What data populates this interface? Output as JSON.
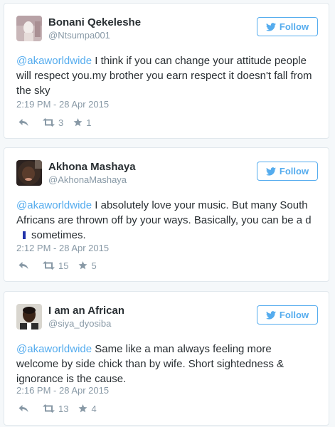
{
  "follow_label": "Follow",
  "colors": {
    "accent": "#55acee",
    "muted": "#8899a6",
    "text": "#292f33",
    "background": "#f5f8fa"
  },
  "tweets": [
    {
      "name": "Bonani Qekeleshe",
      "handle": "@Ntsumpa001",
      "mention": "@akaworldwide",
      "text": " I think if you can change your attitude people will respect you.my brother you earn respect it doesn't fall from the sky",
      "timestamp": "2:19 PM - 28 Apr 2015",
      "retweets": "3",
      "favorites": "1"
    },
    {
      "name": "Akhona Mashaya",
      "handle": "@AkhonaMashaya",
      "mention": "@akaworldwide",
      "text": " I absolutely love your music. But many South Africans are thrown off by your ways. Basically, you can be a d",
      "text_after": "sometimes.",
      "timestamp": "2:12 PM - 28 Apr 2015",
      "retweets": "15",
      "favorites": "5"
    },
    {
      "name": "I am an African",
      "handle": "@siya_dyosiba",
      "mention": "@akaworldwide",
      "text": " Same like a man always feeling more welcome by side chick than by wife. Short sightedness & ignorance is the cause.",
      "timestamp": "2:16 PM - 28 Apr 2015",
      "retweets": "13",
      "favorites": "4"
    }
  ]
}
